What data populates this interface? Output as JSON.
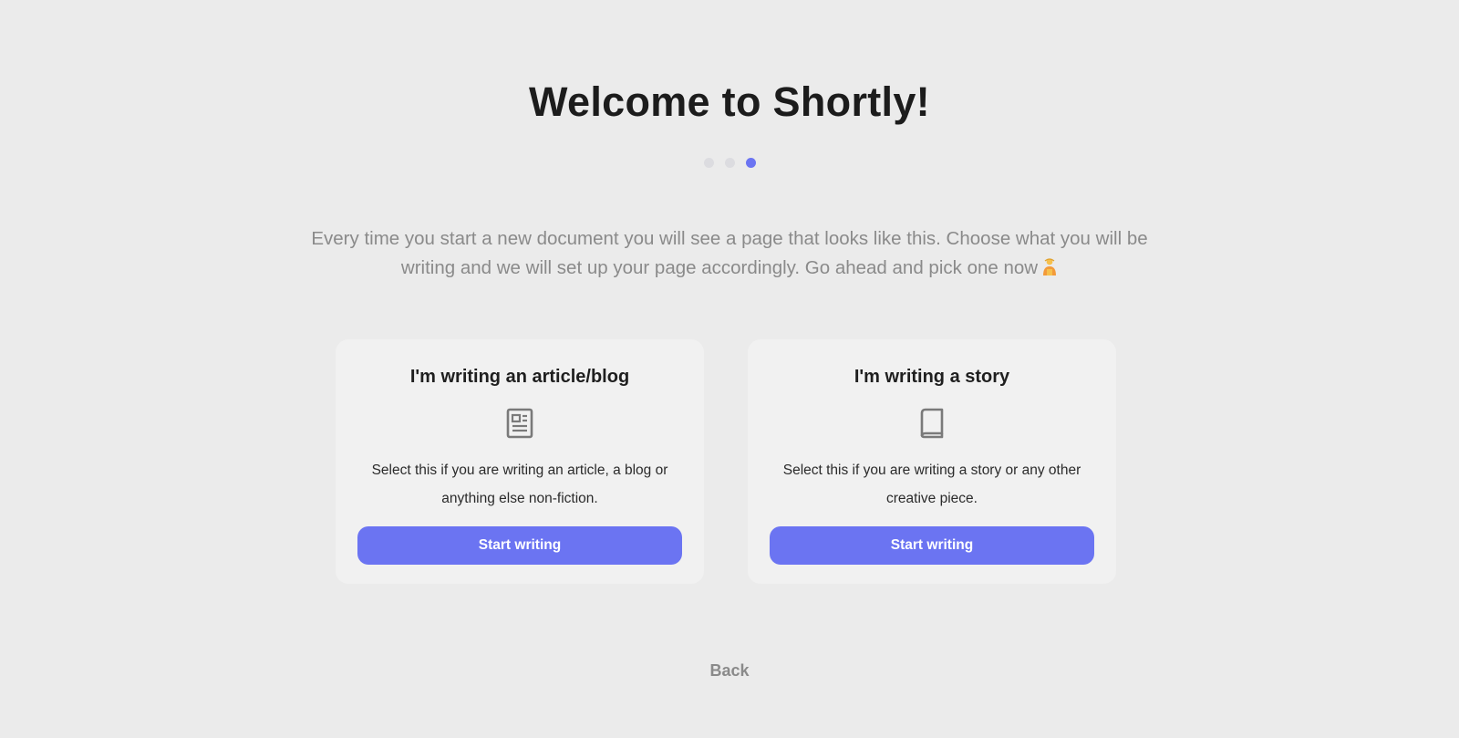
{
  "header": {
    "title": "Welcome to Shortly!"
  },
  "steps": {
    "total": 3,
    "current": 3
  },
  "intro": {
    "text": "Every time you start a new document you will see a page that looks like this. Choose what you will be writing and we will set up your page accordingly. Go ahead and pick one now",
    "emoji": "person-emoji"
  },
  "cards": [
    {
      "title": "I'm writing an article/blog",
      "icon": "article-icon",
      "description": "Select this if you are writing an article, a blog or anything else non-fiction.",
      "button_label": "Start writing"
    },
    {
      "title": "I'm writing a story",
      "icon": "book-icon",
      "description": "Select this if you are writing a story or any other creative piece.",
      "button_label": "Start writing"
    }
  ],
  "footer": {
    "back_label": "Back"
  },
  "colors": {
    "accent": "#6b74f2",
    "background": "#ebebeb",
    "card": "#f1f1f1",
    "muted_text": "#8a8a8a"
  }
}
